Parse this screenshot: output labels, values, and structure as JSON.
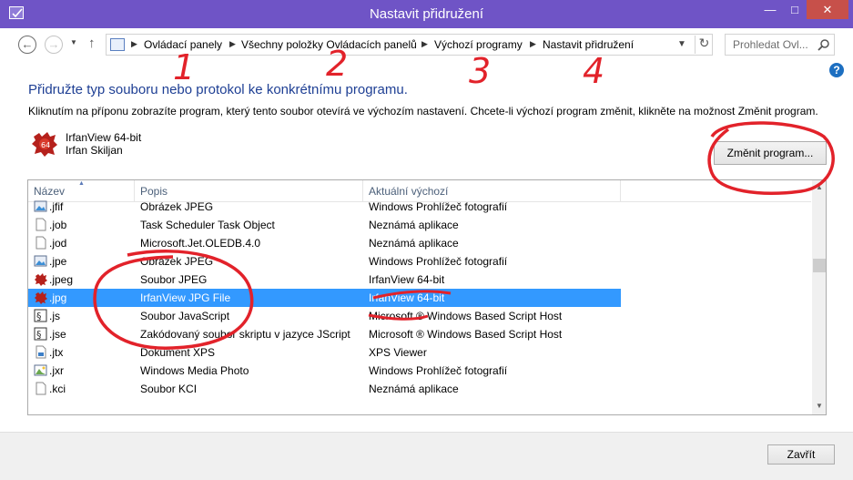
{
  "window": {
    "title": "Nastavit přidružení",
    "minimize": "—",
    "maximize": "□",
    "close": "✕"
  },
  "nav": {
    "breadcrumbs": [
      "Ovládací panely",
      "Všechny položky Ovládacích panelů",
      "Výchozí programy",
      "Nastavit přidružení"
    ],
    "search_placeholder": "Prohledat Ovl..."
  },
  "main": {
    "heading": "Přidružte typ souboru nebo protokol ke konkrétnímu programu.",
    "description": "Kliknutím na příponu zobrazíte program, který tento soubor otevírá ve výchozím nastavení. Chcete-li výchozí program změnit, klikněte na možnost Změnit program.",
    "program_name": "IrfanView 64-bit",
    "program_company": "Irfan Skiljan",
    "change_button": "Změnit program..."
  },
  "list": {
    "columns": [
      "Název",
      "Popis",
      "Aktuální výchozí"
    ],
    "rows": [
      {
        "ext": ".jfif",
        "desc": "Obrázek JPEG",
        "default": "Windows Prohlížeč fotografií",
        "icon": "photo-icon",
        "selected": false
      },
      {
        "ext": ".job",
        "desc": "Task Scheduler Task Object",
        "default": "Neznámá aplikace",
        "icon": "blank-file-icon",
        "selected": false
      },
      {
        "ext": ".jod",
        "desc": "Microsoft.Jet.OLEDB.4.0",
        "default": "Neznámá aplikace",
        "icon": "blank-file-icon",
        "selected": false
      },
      {
        "ext": ".jpe",
        "desc": "Obrázek JPEG",
        "default": "Windows Prohlížeč fotografií",
        "icon": "photo-icon",
        "selected": false
      },
      {
        "ext": ".jpeg",
        "desc": "Soubor JPEG",
        "default": "IrfanView 64-bit",
        "icon": "irfanview-icon",
        "selected": false
      },
      {
        "ext": ".jpg",
        "desc": "IrfanView JPG File",
        "default": "IrfanView 64-bit",
        "icon": "irfanview-icon",
        "selected": true
      },
      {
        "ext": ".js",
        "desc": "Soubor JavaScript",
        "default": "Microsoft ® Windows Based Script Host",
        "icon": "script-icon",
        "selected": false
      },
      {
        "ext": ".jse",
        "desc": "Zakódovaný soubor skriptu v jazyce JScript",
        "default": "Microsoft ® Windows Based Script Host",
        "icon": "script-icon",
        "selected": false
      },
      {
        "ext": ".jtx",
        "desc": "Dokument XPS",
        "default": "XPS Viewer",
        "icon": "xps-icon",
        "selected": false
      },
      {
        "ext": ".jxr",
        "desc": "Windows Media Photo",
        "default": "Windows Prohlížeč fotografií",
        "icon": "media-photo-icon",
        "selected": false
      },
      {
        "ext": ".kci",
        "desc": "Soubor KCI",
        "default": "Neznámá aplikace",
        "icon": "blank-file-icon",
        "selected": false
      }
    ]
  },
  "footer": {
    "close_button": "Zavřít"
  },
  "annotations": {
    "numbers": [
      "1",
      "2",
      "3",
      "4"
    ]
  },
  "colors": {
    "titlebar": "#6f54c6",
    "heading": "#1e3f94",
    "selection": "#3399ff",
    "annotation": "#e2222a"
  }
}
